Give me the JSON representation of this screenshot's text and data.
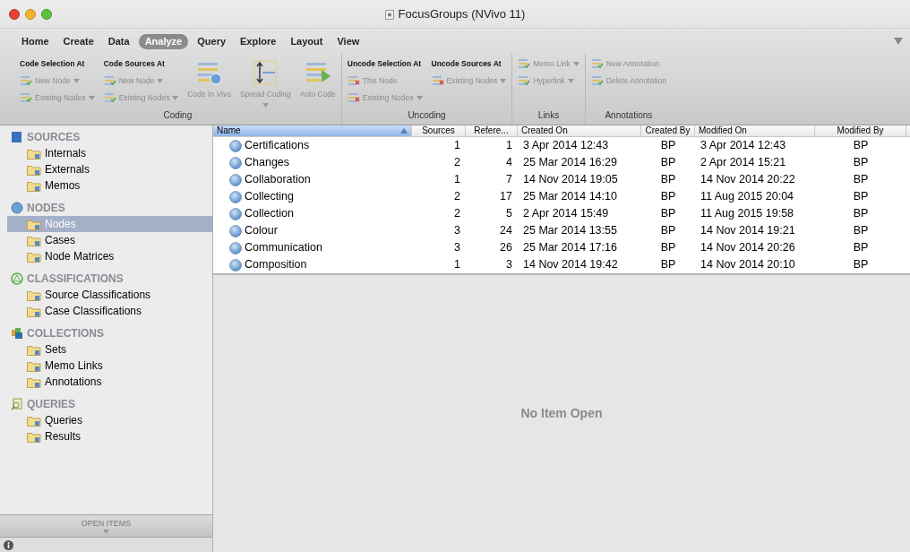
{
  "window": {
    "title": "FocusGroups (NVivo 11)"
  },
  "tabs": [
    {
      "label": "Home",
      "selected": false
    },
    {
      "label": "Create",
      "selected": false
    },
    {
      "label": "Data",
      "selected": false
    },
    {
      "label": "Analyze",
      "selected": true
    },
    {
      "label": "Query",
      "selected": false
    },
    {
      "label": "Explore",
      "selected": false
    },
    {
      "label": "Layout",
      "selected": false
    },
    {
      "label": "View",
      "selected": false
    }
  ],
  "ribbon": {
    "groups": [
      {
        "label": "Coding",
        "columns": [
          {
            "kind": "small",
            "heading": "Code Selection At",
            "items": [
              {
                "label": "New Node",
                "dropdown": true
              },
              {
                "label": "Existing Nodes",
                "dropdown": true
              }
            ]
          },
          {
            "kind": "small",
            "heading": "Code Sources At",
            "items": [
              {
                "label": "New Node",
                "dropdown": true
              },
              {
                "label": "Existing Nodes",
                "dropdown": true
              }
            ]
          },
          {
            "kind": "large",
            "label": "Code In Vivo",
            "dropdown": false
          },
          {
            "kind": "large",
            "label": "Spread Coding",
            "dropdown": true
          },
          {
            "kind": "large",
            "label": "Auto Code",
            "dropdown": false
          }
        ]
      },
      {
        "label": "Uncoding",
        "columns": [
          {
            "kind": "small",
            "heading": "Uncode Selection At",
            "items": [
              {
                "label": "This Node",
                "dropdown": false
              },
              {
                "label": "Existing Nodes",
                "dropdown": true
              }
            ]
          },
          {
            "kind": "small",
            "heading": "Uncode Sources At",
            "items": [
              {
                "label": "Existing Nodes",
                "dropdown": true
              }
            ]
          }
        ]
      },
      {
        "label": "Links",
        "columns": [
          {
            "kind": "small",
            "items": [
              {
                "label": "Memo Link",
                "dropdown": true
              },
              {
                "label": "Hyperlink",
                "dropdown": true
              }
            ]
          }
        ]
      },
      {
        "label": "Annotations",
        "columns": [
          {
            "kind": "small",
            "items": [
              {
                "label": "New Annotation",
                "dropdown": false
              },
              {
                "label": "Delete Annotation",
                "dropdown": false
              }
            ]
          }
        ]
      }
    ]
  },
  "sidebar": {
    "sections": [
      {
        "label": "SOURCES",
        "items": [
          {
            "label": "Internals",
            "selected": false
          },
          {
            "label": "Externals",
            "selected": false
          },
          {
            "label": "Memos",
            "selected": false
          }
        ]
      },
      {
        "label": "NODES",
        "items": [
          {
            "label": "Nodes",
            "selected": true
          },
          {
            "label": "Cases",
            "selected": false
          },
          {
            "label": "Node Matrices",
            "selected": false
          }
        ]
      },
      {
        "label": "CLASSIFICATIONS",
        "items": [
          {
            "label": "Source Classifications",
            "selected": false
          },
          {
            "label": "Case Classifications",
            "selected": false
          }
        ]
      },
      {
        "label": "COLLECTIONS",
        "items": [
          {
            "label": "Sets",
            "selected": false
          },
          {
            "label": "Memo Links",
            "selected": false
          },
          {
            "label": "Annotations",
            "selected": false
          }
        ]
      },
      {
        "label": "QUERIES",
        "items": [
          {
            "label": "Queries",
            "selected": false
          },
          {
            "label": "Results",
            "selected": false
          }
        ]
      }
    ],
    "open_items": "OPEN ITEMS"
  },
  "table": {
    "columns": [
      {
        "label": "Name",
        "kind": "name",
        "selected": true
      },
      {
        "label": "Sources",
        "kind": "number",
        "selected": false
      },
      {
        "label": "Refere...",
        "kind": "number",
        "selected": false
      },
      {
        "label": "Created On",
        "kind": "text",
        "selected": false
      },
      {
        "label": "Created By",
        "kind": "initials",
        "selected": false
      },
      {
        "label": "Modified On",
        "kind": "text",
        "selected": false
      },
      {
        "label": "Modified By",
        "kind": "initials",
        "selected": false
      }
    ],
    "rows": [
      [
        "Certifications",
        "1",
        "1",
        "3 Apr 2014 12:43",
        "BP",
        "3 Apr 2014 12:43",
        "BP"
      ],
      [
        "Changes",
        "2",
        "4",
        "25 Mar 2014 16:29",
        "BP",
        "2 Apr 2014 15:21",
        "BP"
      ],
      [
        "Collaboration",
        "1",
        "7",
        "14 Nov 2014 19:05",
        "BP",
        "14 Nov 2014 20:22",
        "BP"
      ],
      [
        "Collecting",
        "2",
        "17",
        "25 Mar 2014 14:10",
        "BP",
        "11 Aug 2015 20:04",
        "BP"
      ],
      [
        "Collection",
        "2",
        "5",
        "2 Apr 2014 15:49",
        "BP",
        "11 Aug 2015 19:58",
        "BP"
      ],
      [
        "Colour",
        "3",
        "24",
        "25 Mar 2014 13:55",
        "BP",
        "14 Nov 2014 19:21",
        "BP"
      ],
      [
        "Communication",
        "3",
        "26",
        "25 Mar 2014 17:16",
        "BP",
        "14 Nov 2014 20:26",
        "BP"
      ],
      [
        "Composition",
        "1",
        "3",
        "14 Nov 2014 19:42",
        "BP",
        "14 Nov 2014 20:10",
        "BP"
      ]
    ]
  },
  "detail": {
    "message": "No Item Open"
  }
}
